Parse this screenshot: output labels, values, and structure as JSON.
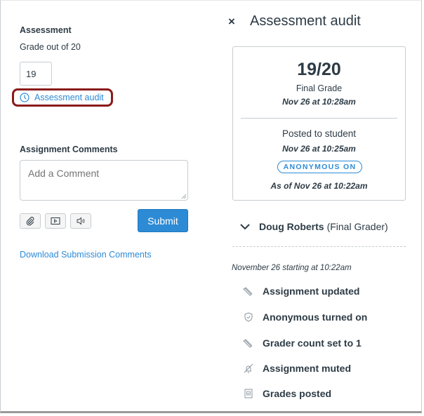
{
  "assessment": {
    "heading": "Assessment",
    "grade_out_of": "Grade out of 20",
    "grade_value": "19",
    "audit_link": "Assessment audit"
  },
  "comments": {
    "heading": "Assignment Comments",
    "placeholder": "Add a Comment",
    "submit_label": "Submit",
    "download_link": "Download Submission Comments",
    "media_buttons": [
      "attach-file",
      "media-comment",
      "audio-comment"
    ]
  },
  "audit_panel": {
    "close_label": "×",
    "title": "Assessment audit",
    "summary": {
      "grade": "19/20",
      "grade_label": "Final Grade",
      "grade_time": "Nov 26 at 10:28am",
      "posted_label": "Posted to student",
      "posted_time": "Nov 26 at 10:25am",
      "badge": "ANONYMOUS ON",
      "as_of": "As of Nov 26 at 10:22am"
    },
    "grader": {
      "name": "Doug Roberts",
      "role": "(Final Grader)"
    },
    "date_header": "November 26 starting at 10:22am",
    "events": [
      {
        "icon": "pencil-icon",
        "label": "Assignment updated"
      },
      {
        "icon": "shield-icon",
        "label": "Anonymous turned on"
      },
      {
        "icon": "pencil-icon",
        "label": "Grader count set to 1"
      },
      {
        "icon": "muted-bell-icon",
        "label": "Assignment muted"
      },
      {
        "icon": "gradebook-icon",
        "label": "Grades posted"
      }
    ]
  },
  "colors": {
    "link": "#2d8bd6",
    "highlight_border": "#8b1a1a",
    "text": "#2d3b45"
  }
}
